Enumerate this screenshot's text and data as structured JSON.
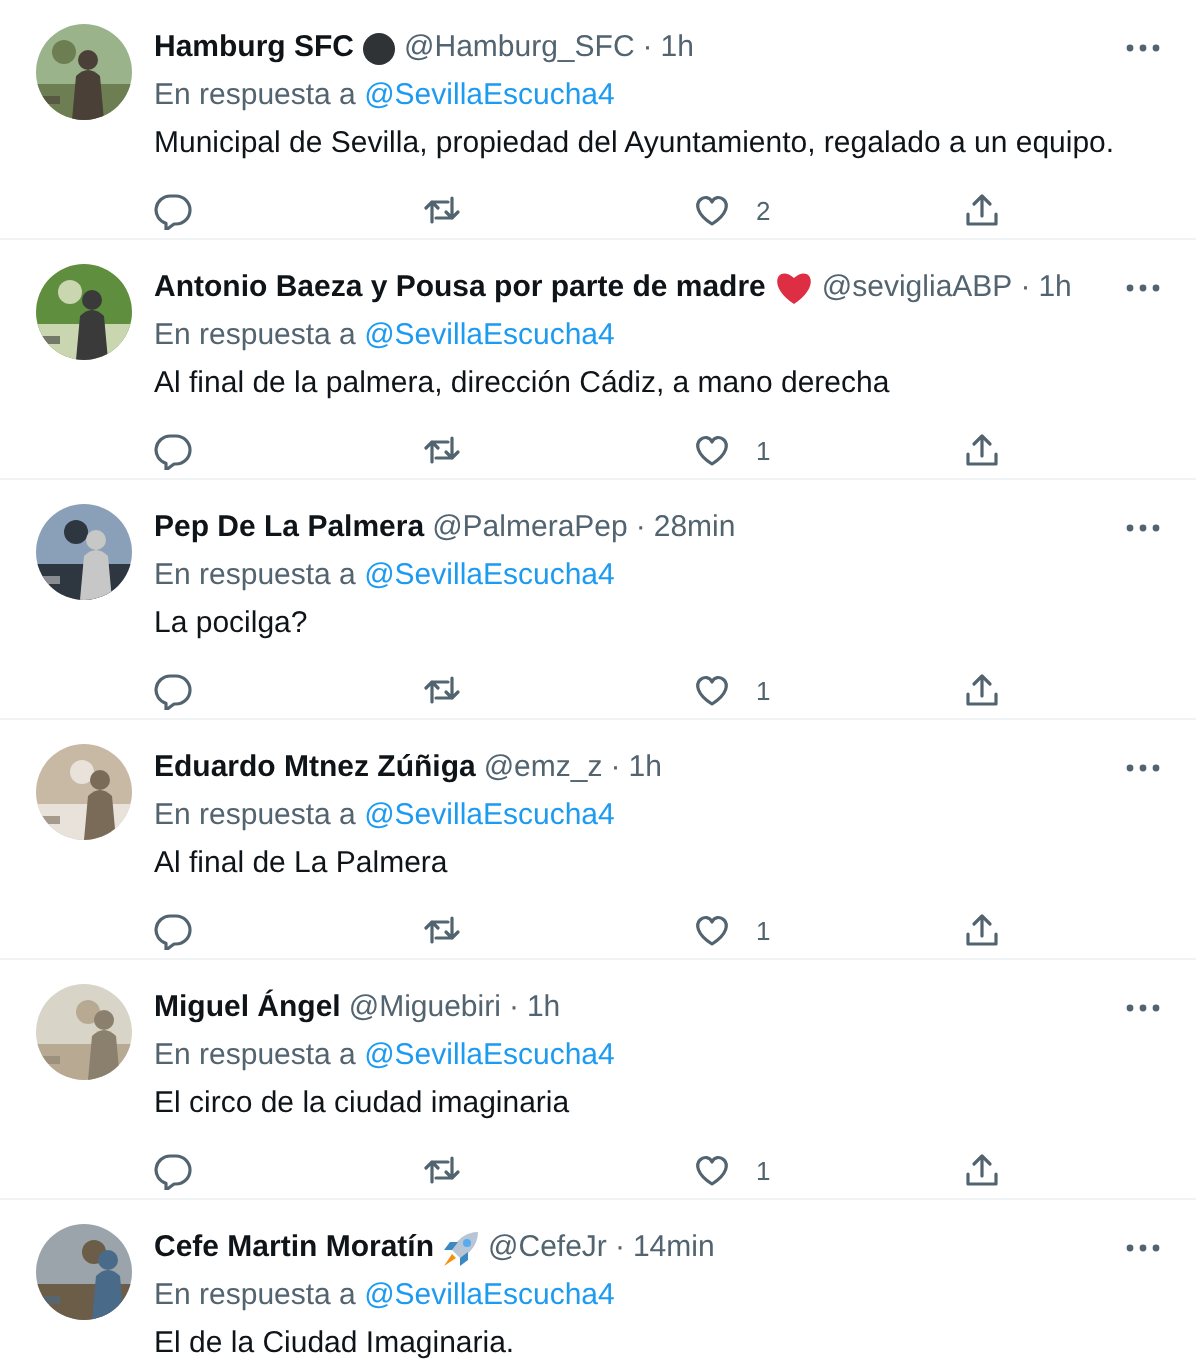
{
  "tweets": [
    {
      "name": "Hamburg SFC",
      "badge": {
        "kind": "dot"
      },
      "handle": "@Hamburg_SFC",
      "separator": "·",
      "time": "1h",
      "reply_prefix": "En respuesta a",
      "reply_to": "@SevillaEscucha4",
      "text": "Municipal de Sevilla, propiedad del Ayuntamiento, regalado a un equipo.",
      "likes": "2"
    },
    {
      "name": "Antonio Baeza y Pousa por parte de madre",
      "badge": {
        "kind": "heart"
      },
      "handle": "@sevigliaABP",
      "separator": "·",
      "time": "1h",
      "reply_prefix": "En respuesta a",
      "reply_to": "@SevillaEscucha4",
      "text": "Al final de la palmera, dirección Cádiz, a mano derecha",
      "likes": "1"
    },
    {
      "name": "Pep De La Palmera",
      "handle": "@PalmeraPep",
      "separator": "·",
      "time": "28min",
      "reply_prefix": "En respuesta a",
      "reply_to": "@SevillaEscucha4",
      "text": "La pocilga?",
      "likes": "1"
    },
    {
      "name": "Eduardo Mtnez Zúñiga",
      "handle": "@emz_z",
      "separator": "·",
      "time": "1h",
      "reply_prefix": "En respuesta a",
      "reply_to": "@SevillaEscucha4",
      "text": "Al final de La Palmera",
      "likes": "1"
    },
    {
      "name": "Miguel Ángel",
      "handle": "@Miguebiri",
      "separator": "·",
      "time": "1h",
      "reply_prefix": "En respuesta a",
      "reply_to": "@SevillaEscucha4",
      "text": "El circo de la ciudad imaginaria",
      "likes": "1"
    },
    {
      "name": "Cefe Martin Moratín",
      "badge": {
        "kind": "rocket"
      },
      "handle": "@CefeJr",
      "separator": "·",
      "time": "14min",
      "reply_prefix": "En respuesta a",
      "reply_to": "@SevillaEscucha4",
      "text": "El de la Ciudad Imaginaria."
    }
  ]
}
